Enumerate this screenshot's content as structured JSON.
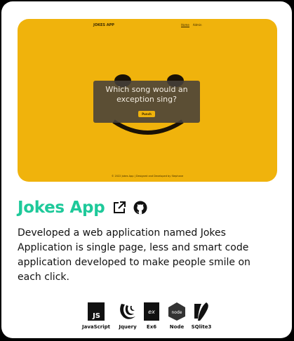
{
  "preview": {
    "brand": "JOKES APP",
    "nav": [
      "Home",
      "Admin"
    ],
    "joke": "Which song would an exception sing?",
    "punch_label": "Punch",
    "footer": "© 2022 Jokes App | Designed and Developed by Stephane"
  },
  "project": {
    "title": "Jokes App",
    "description": "Developed a web application named Jokes Application is single page, less and smart code application developed to make people smile on each click."
  },
  "tech": [
    {
      "label": "JavaScript",
      "icon": "javascript-icon",
      "badge": "JS"
    },
    {
      "label": "Jquery",
      "icon": "jquery-icon"
    },
    {
      "label": "Ex6",
      "icon": "express-icon",
      "badge": "ex"
    },
    {
      "label": "Node",
      "icon": "node-icon",
      "badge": "node"
    },
    {
      "label": "SQlite3",
      "icon": "sqlite-icon"
    }
  ],
  "colors": {
    "accent": "#1ec99a",
    "preview_bg": "#f0b30c",
    "joke_box": "#46403a"
  }
}
